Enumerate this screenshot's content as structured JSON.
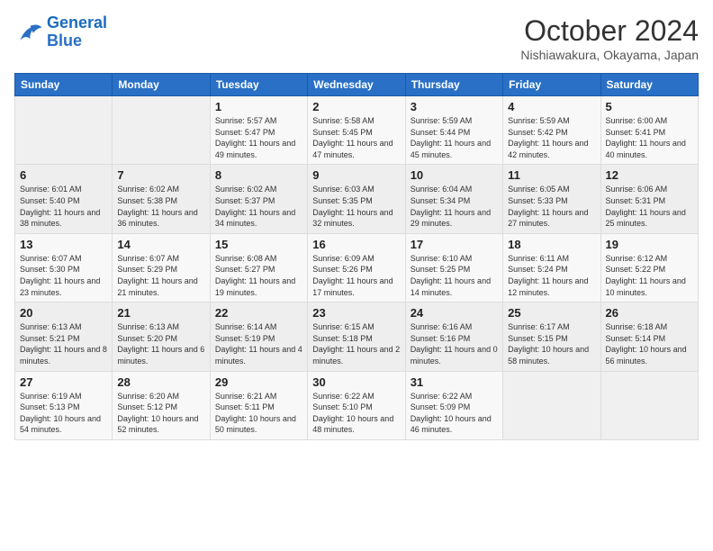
{
  "header": {
    "logo_line1": "General",
    "logo_line2": "Blue",
    "month": "October 2024",
    "location": "Nishiawakura, Okayama, Japan"
  },
  "weekdays": [
    "Sunday",
    "Monday",
    "Tuesday",
    "Wednesday",
    "Thursday",
    "Friday",
    "Saturday"
  ],
  "weeks": [
    [
      null,
      null,
      {
        "day": 1,
        "sunrise": "5:57 AM",
        "sunset": "5:47 PM",
        "daylight": "11 hours and 49 minutes."
      },
      {
        "day": 2,
        "sunrise": "5:58 AM",
        "sunset": "5:45 PM",
        "daylight": "11 hours and 47 minutes."
      },
      {
        "day": 3,
        "sunrise": "5:59 AM",
        "sunset": "5:44 PM",
        "daylight": "11 hours and 45 minutes."
      },
      {
        "day": 4,
        "sunrise": "5:59 AM",
        "sunset": "5:42 PM",
        "daylight": "11 hours and 42 minutes."
      },
      {
        "day": 5,
        "sunrise": "6:00 AM",
        "sunset": "5:41 PM",
        "daylight": "11 hours and 40 minutes."
      }
    ],
    [
      {
        "day": 6,
        "sunrise": "6:01 AM",
        "sunset": "5:40 PM",
        "daylight": "11 hours and 38 minutes."
      },
      {
        "day": 7,
        "sunrise": "6:02 AM",
        "sunset": "5:38 PM",
        "daylight": "11 hours and 36 minutes."
      },
      {
        "day": 8,
        "sunrise": "6:02 AM",
        "sunset": "5:37 PM",
        "daylight": "11 hours and 34 minutes."
      },
      {
        "day": 9,
        "sunrise": "6:03 AM",
        "sunset": "5:35 PM",
        "daylight": "11 hours and 32 minutes."
      },
      {
        "day": 10,
        "sunrise": "6:04 AM",
        "sunset": "5:34 PM",
        "daylight": "11 hours and 29 minutes."
      },
      {
        "day": 11,
        "sunrise": "6:05 AM",
        "sunset": "5:33 PM",
        "daylight": "11 hours and 27 minutes."
      },
      {
        "day": 12,
        "sunrise": "6:06 AM",
        "sunset": "5:31 PM",
        "daylight": "11 hours and 25 minutes."
      }
    ],
    [
      {
        "day": 13,
        "sunrise": "6:07 AM",
        "sunset": "5:30 PM",
        "daylight": "11 hours and 23 minutes."
      },
      {
        "day": 14,
        "sunrise": "6:07 AM",
        "sunset": "5:29 PM",
        "daylight": "11 hours and 21 minutes."
      },
      {
        "day": 15,
        "sunrise": "6:08 AM",
        "sunset": "5:27 PM",
        "daylight": "11 hours and 19 minutes."
      },
      {
        "day": 16,
        "sunrise": "6:09 AM",
        "sunset": "5:26 PM",
        "daylight": "11 hours and 17 minutes."
      },
      {
        "day": 17,
        "sunrise": "6:10 AM",
        "sunset": "5:25 PM",
        "daylight": "11 hours and 14 minutes."
      },
      {
        "day": 18,
        "sunrise": "6:11 AM",
        "sunset": "5:24 PM",
        "daylight": "11 hours and 12 minutes."
      },
      {
        "day": 19,
        "sunrise": "6:12 AM",
        "sunset": "5:22 PM",
        "daylight": "11 hours and 10 minutes."
      }
    ],
    [
      {
        "day": 20,
        "sunrise": "6:13 AM",
        "sunset": "5:21 PM",
        "daylight": "11 hours and 8 minutes."
      },
      {
        "day": 21,
        "sunrise": "6:13 AM",
        "sunset": "5:20 PM",
        "daylight": "11 hours and 6 minutes."
      },
      {
        "day": 22,
        "sunrise": "6:14 AM",
        "sunset": "5:19 PM",
        "daylight": "11 hours and 4 minutes."
      },
      {
        "day": 23,
        "sunrise": "6:15 AM",
        "sunset": "5:18 PM",
        "daylight": "11 hours and 2 minutes."
      },
      {
        "day": 24,
        "sunrise": "6:16 AM",
        "sunset": "5:16 PM",
        "daylight": "11 hours and 0 minutes."
      },
      {
        "day": 25,
        "sunrise": "6:17 AM",
        "sunset": "5:15 PM",
        "daylight": "10 hours and 58 minutes."
      },
      {
        "day": 26,
        "sunrise": "6:18 AM",
        "sunset": "5:14 PM",
        "daylight": "10 hours and 56 minutes."
      }
    ],
    [
      {
        "day": 27,
        "sunrise": "6:19 AM",
        "sunset": "5:13 PM",
        "daylight": "10 hours and 54 minutes."
      },
      {
        "day": 28,
        "sunrise": "6:20 AM",
        "sunset": "5:12 PM",
        "daylight": "10 hours and 52 minutes."
      },
      {
        "day": 29,
        "sunrise": "6:21 AM",
        "sunset": "5:11 PM",
        "daylight": "10 hours and 50 minutes."
      },
      {
        "day": 30,
        "sunrise": "6:22 AM",
        "sunset": "5:10 PM",
        "daylight": "10 hours and 48 minutes."
      },
      {
        "day": 31,
        "sunrise": "6:22 AM",
        "sunset": "5:09 PM",
        "daylight": "10 hours and 46 minutes."
      },
      null,
      null
    ]
  ]
}
